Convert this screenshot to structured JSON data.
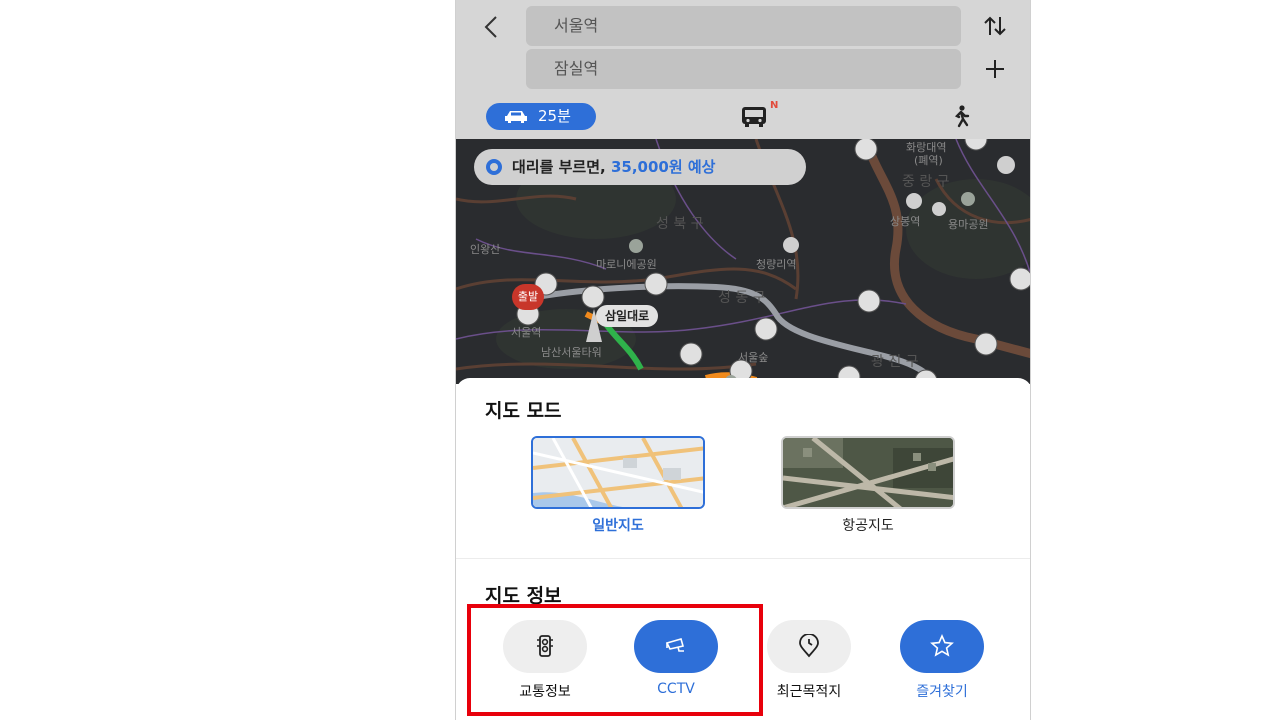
{
  "route": {
    "back_icon": "chevron-left-icon",
    "origin": "서울역",
    "destination": "잠실역",
    "swap_icon": "swap-vertical-icon",
    "add_icon": "plus-icon"
  },
  "transport_tabs": {
    "car": {
      "icon": "car-icon",
      "label": "25분",
      "selected": true
    },
    "transit": {
      "icon": "bus-icon",
      "badge": "N"
    },
    "walk": {
      "icon": "walk-icon"
    }
  },
  "map": {
    "driver_banner": {
      "icon": "steering-wheel-icon",
      "text": "대리를 부르면, ",
      "price": "35,000원 예상"
    },
    "road_label": "삼일대로",
    "start_marker": "출발",
    "labels": {
      "cheongnyangni": "청량리역",
      "naksan": "마로니에공원",
      "seoul_station": "서울역",
      "namsan": "남산서울타워",
      "sangbong": "상봉역",
      "yongma": "용마공원",
      "hwarang": "화랑대역",
      "closed": "(폐역)",
      "inwangsan": "인왕산",
      "seongbuk": "성 북 구",
      "jungnang": "중 랑 구",
      "seongdong": "성 동 구",
      "gwangjin": "광 진 구",
      "seoulsup": "서울숲"
    },
    "colors": {
      "route": "#9a9ea5",
      "traffic_slow": "#f08a1c",
      "traffic_smooth": "#2fb24b"
    }
  },
  "sheet": {
    "map_mode": {
      "title": "지도 모드",
      "options": [
        {
          "label": "일반지도",
          "selected": true
        },
        {
          "label": "항공지도",
          "selected": false
        }
      ]
    },
    "map_info": {
      "title": "지도 정보",
      "items": [
        {
          "label": "교통정보",
          "icon": "traffic-light-icon",
          "active": false
        },
        {
          "label": "CCTV",
          "icon": "cctv-icon",
          "active": true
        },
        {
          "label": "최근목적지",
          "icon": "recent-pin-icon",
          "active": false
        },
        {
          "label": "즐겨찾기",
          "icon": "star-icon",
          "active": true
        }
      ]
    }
  },
  "colors": {
    "accent": "#2e6fd8",
    "highlight": "#e8000b",
    "map_bg": "#2a2c2f"
  }
}
